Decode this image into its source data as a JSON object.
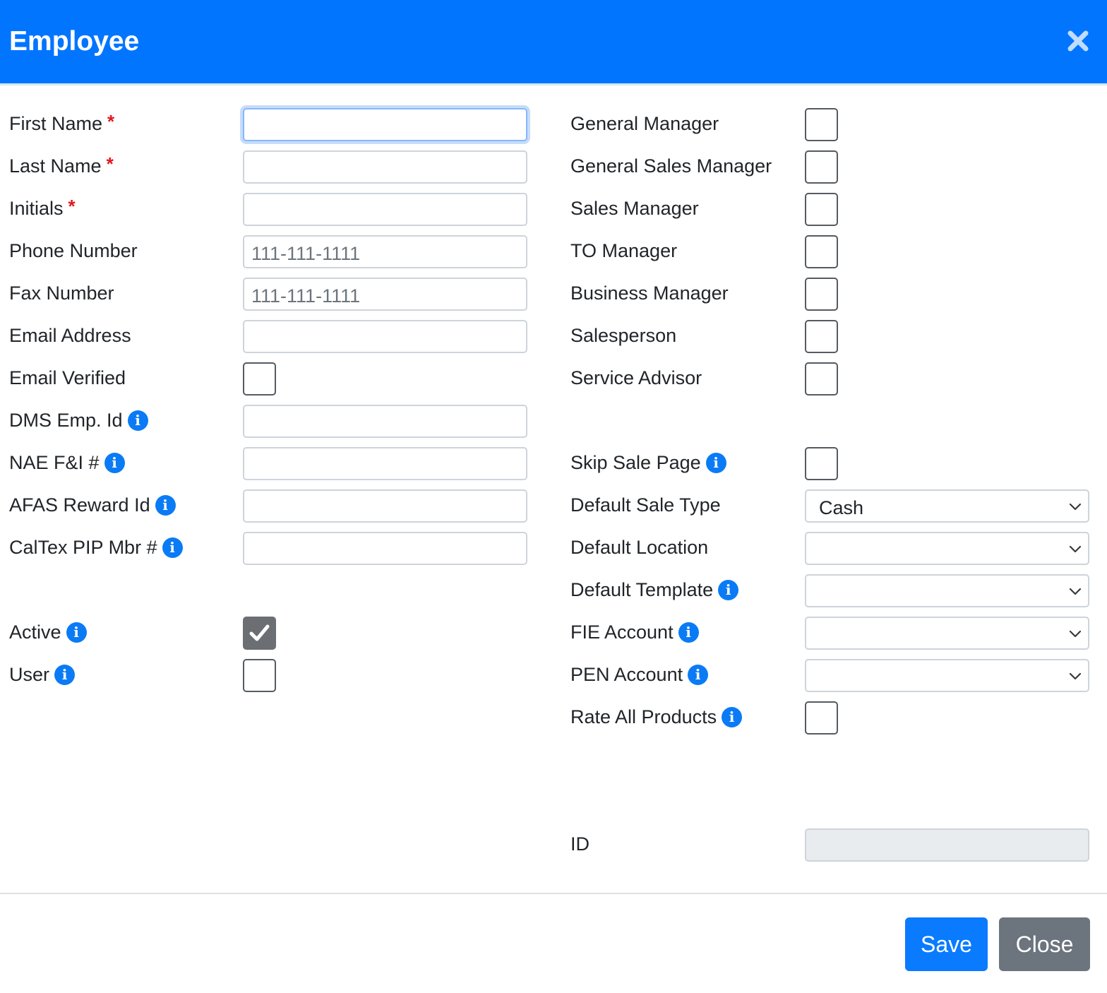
{
  "dialog": {
    "title": "Employee",
    "close_icon": "close-icon"
  },
  "left": {
    "first_name": {
      "label": "First Name",
      "required": "*",
      "value": ""
    },
    "last_name": {
      "label": "Last Name",
      "required": "*",
      "value": ""
    },
    "initials": {
      "label": "Initials",
      "required": "*",
      "value": ""
    },
    "phone_number": {
      "label": "Phone Number",
      "placeholder": "111-111-1111"
    },
    "fax_number": {
      "label": "Fax Number",
      "placeholder": "111-111-1111"
    },
    "email_address": {
      "label": "Email Address",
      "value": ""
    },
    "email_verified": {
      "label": "Email Verified",
      "checked": false
    },
    "dms_emp_id": {
      "label": "DMS Emp. Id",
      "value": ""
    },
    "nae_fi": {
      "label": "NAE F&I #",
      "value": ""
    },
    "afas_reward_id": {
      "label": "AFAS Reward Id",
      "value": ""
    },
    "caltex_pip": {
      "label": "CalTex PIP Mbr #",
      "value": ""
    },
    "active": {
      "label": "Active",
      "checked": true
    },
    "user": {
      "label": "User",
      "checked": false
    }
  },
  "right": {
    "general_manager": {
      "label": "General Manager",
      "checked": false
    },
    "general_sales_manager": {
      "label": "General Sales Manager",
      "checked": false
    },
    "sales_manager": {
      "label": "Sales Manager",
      "checked": false
    },
    "to_manager": {
      "label": "TO Manager",
      "checked": false
    },
    "business_manager": {
      "label": "Business Manager",
      "checked": false
    },
    "salesperson": {
      "label": "Salesperson",
      "checked": false
    },
    "service_advisor": {
      "label": "Service Advisor",
      "checked": false
    },
    "skip_sale_page": {
      "label": "Skip Sale Page",
      "checked": false
    },
    "default_sale_type": {
      "label": "Default Sale Type",
      "value": "Cash"
    },
    "default_location": {
      "label": "Default Location",
      "value": ""
    },
    "default_template": {
      "label": "Default Template",
      "value": ""
    },
    "fie_account": {
      "label": "FIE Account",
      "value": ""
    },
    "pen_account": {
      "label": "PEN Account",
      "value": ""
    },
    "rate_all_products": {
      "label": "Rate All Products",
      "checked": false
    },
    "id": {
      "label": "ID",
      "value": ""
    }
  },
  "footer": {
    "save_label": "Save",
    "close_label": "Close"
  },
  "colors": {
    "header": "#0275ff",
    "info_icon": "#0a7bf5",
    "save_button": "#0a7bfe",
    "close_button": "#6c757d",
    "required": "#e3161b"
  }
}
